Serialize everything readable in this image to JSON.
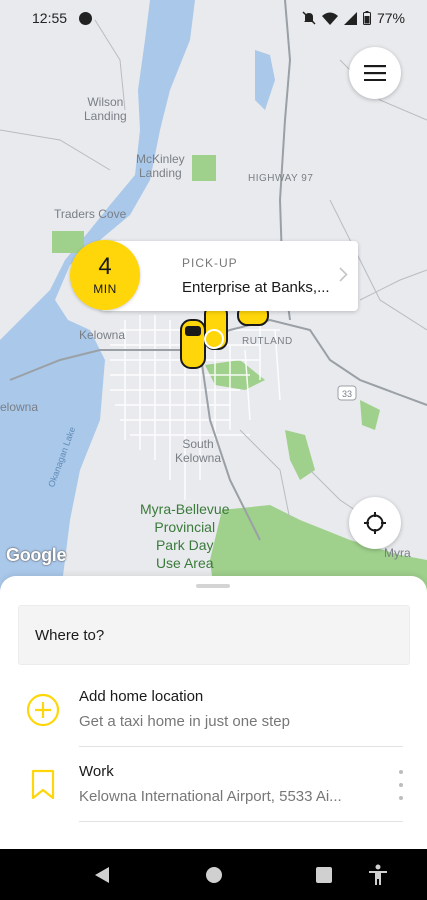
{
  "status_bar": {
    "time": "12:55",
    "battery": "77%",
    "icons": [
      "app-notification-icon",
      "mute-icon",
      "wifi-icon",
      "signal-icon",
      "battery-icon"
    ]
  },
  "map": {
    "labels": {
      "wilson_landing": "Wilson\nLanding",
      "mckinley_landing": "McKinley\nLanding",
      "highway_97": "HIGHWAY 97",
      "traders_cove": "Traders Cove",
      "kelowna": "Kelowna",
      "rutland": "RUTLAND",
      "west_kelowna": "elowna",
      "south_kelowna": "South\nKelowna",
      "okanagan_lake": "Okanagan Lake",
      "park": "Myra-Bellevue\nProvincial\nPark Day\nUse Area",
      "myra": "Myra",
      "route_33": "33"
    },
    "attribution": "Google"
  },
  "pickup": {
    "eta_value": "4",
    "eta_unit": "MIN",
    "label": "PICK-UP",
    "address": "Enterprise at Banks,..."
  },
  "bottom_sheet": {
    "search_placeholder": "Where to?",
    "rows": [
      {
        "title": "Add home location",
        "subtitle": "Get a taxi home in just one step",
        "icon": "add-circle-icon"
      },
      {
        "title": "Work",
        "subtitle": "Kelowna International Airport, 5533 Ai...",
        "icon": "bookmark-icon"
      }
    ]
  },
  "colors": {
    "accent": "#ffd60a",
    "water": "#aac8ea",
    "park": "#9fd08c",
    "map_bg": "#e8eaed"
  }
}
